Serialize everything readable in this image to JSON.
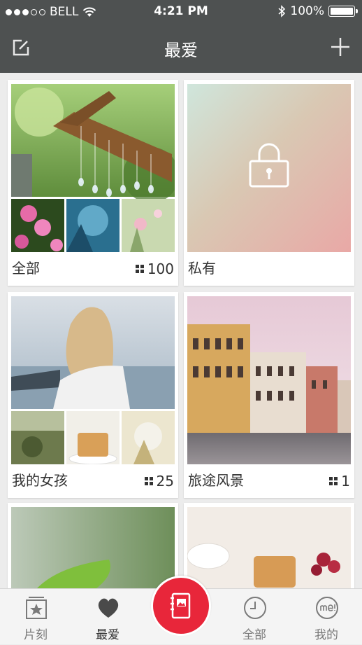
{
  "status_bar": {
    "carrier": "BELL",
    "time": "4:21 PM",
    "battery": "100%"
  },
  "nav": {
    "title": "最爱"
  },
  "albums": [
    {
      "label": "全部",
      "count": "100"
    },
    {
      "label": "私有"
    },
    {
      "label": "我的女孩",
      "count": "25"
    },
    {
      "label": "旅途风景",
      "count": "1"
    }
  ],
  "tabs": [
    {
      "label": "片刻"
    },
    {
      "label": "最爱"
    },
    {
      "label": "全部"
    },
    {
      "label": "我的"
    }
  ],
  "colors": {
    "bar": "#4e5151",
    "accent": "#e8263a",
    "background": "#ececec"
  }
}
